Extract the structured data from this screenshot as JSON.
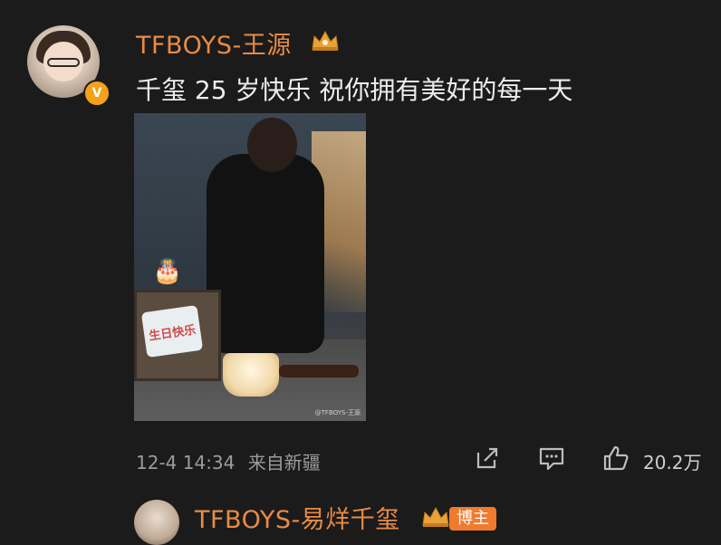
{
  "post": {
    "author_name": "TFBOYS-王源",
    "text": "千玺 25 岁快乐 祝你拥有美好的每一天",
    "verified_mark": "V",
    "image": {
      "tv_text": "生日快乐",
      "watermark": "@TFBOYS-王源"
    },
    "timestamp": "12-4 14:34",
    "source": "来自新疆",
    "like_count": "20.2万"
  },
  "reply": {
    "author_name": "TFBOYS-易烊千玺",
    "badge": "博主"
  },
  "icons": {
    "crown": "crown-icon",
    "share": "share-icon",
    "comment": "comment-icon",
    "like": "thumbs-up-icon"
  },
  "colors": {
    "background": "#1b1b1b",
    "username": "#e88b46",
    "verify": "#f4a21b",
    "badge": "#f07a2e"
  }
}
